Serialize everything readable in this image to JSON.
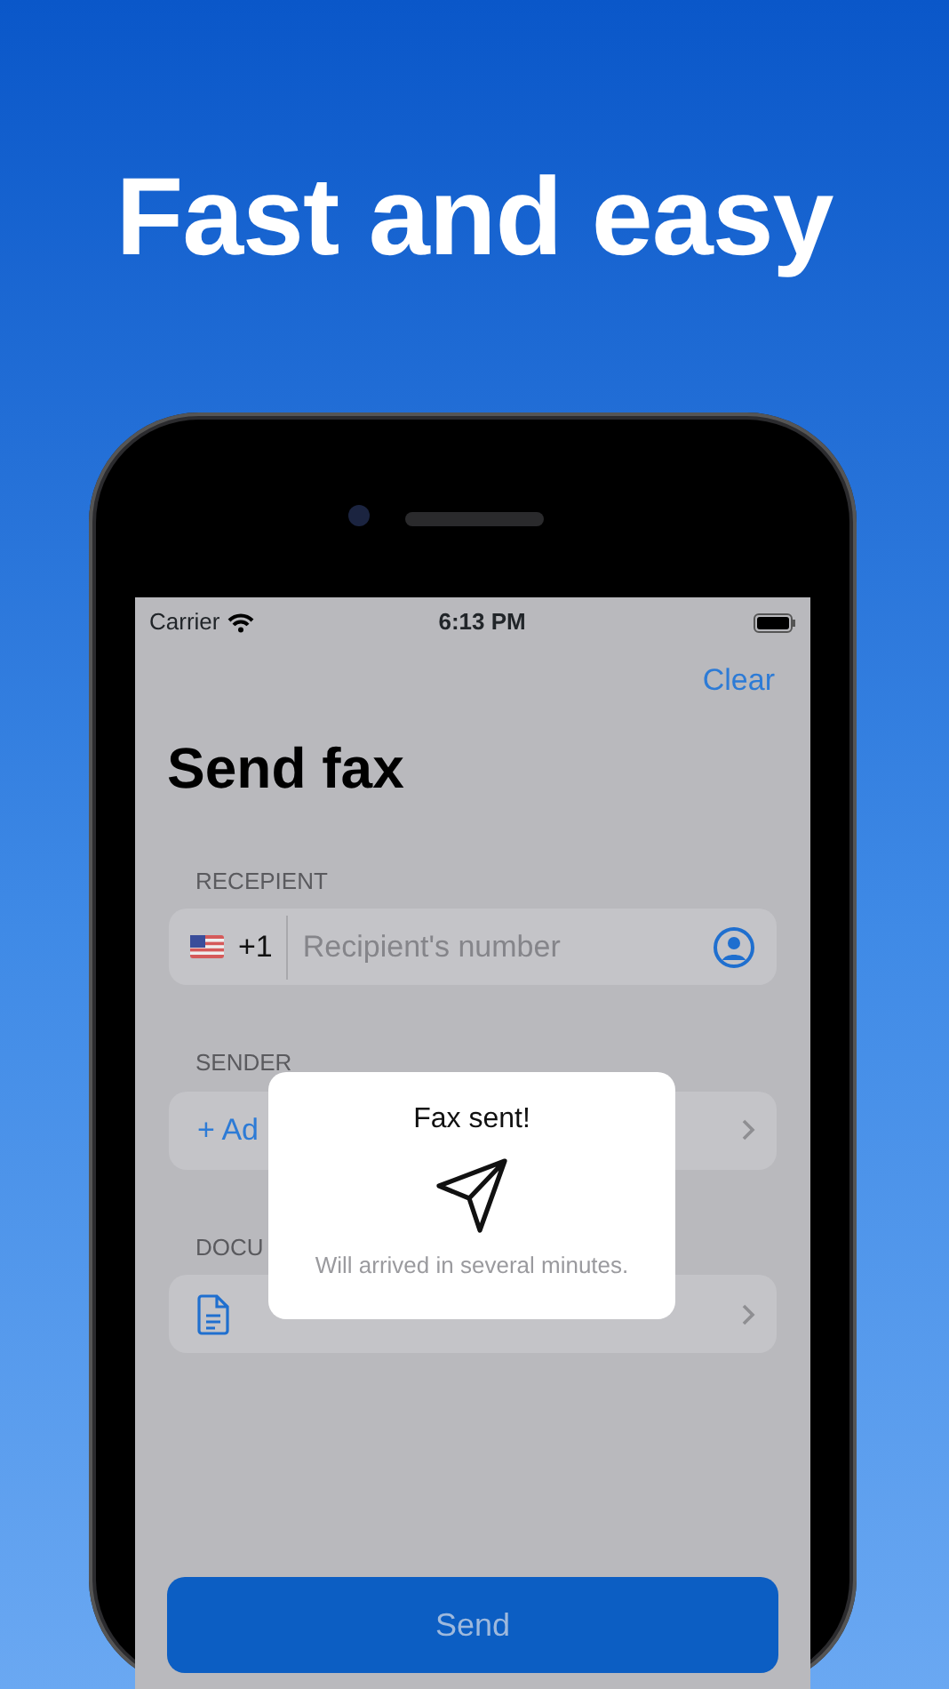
{
  "headline": "Fast and easy",
  "status_bar": {
    "carrier": "Carrier",
    "time": "6:13 PM"
  },
  "nav": {
    "clear_label": "Clear"
  },
  "title": "Send fax",
  "recipient": {
    "label": "RECEPIENT",
    "country_code": "+1",
    "placeholder": "Recipient's number"
  },
  "sender": {
    "label": "SENDER",
    "add_label": "+ Ad"
  },
  "document": {
    "label": "DOCU"
  },
  "send_button": {
    "label": "Send"
  },
  "alert": {
    "title": "Fax sent!",
    "message": "Will arrived in several minutes."
  }
}
